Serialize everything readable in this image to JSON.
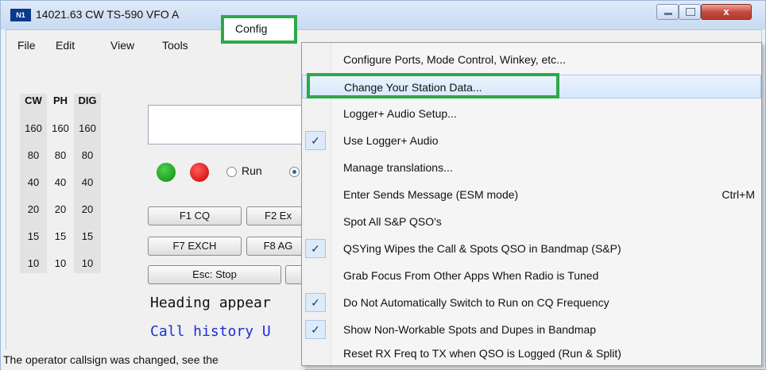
{
  "window": {
    "title": "14021.63 CW TS-590 VFO A",
    "icon_text": "N1",
    "close_label": "x"
  },
  "menubar": {
    "items": [
      "File",
      "Edit",
      "View",
      "Tools",
      "Config"
    ]
  },
  "band_table": {
    "headers": [
      "CW",
      "PH",
      "DIG"
    ],
    "rows": [
      [
        "160",
        "160",
        "160"
      ],
      [
        "80",
        "80",
        "80"
      ],
      [
        "40",
        "40",
        "40"
      ],
      [
        "20",
        "20",
        "20"
      ],
      [
        "15",
        "15",
        "15"
      ],
      [
        "10",
        "10",
        "10"
      ]
    ]
  },
  "mode": {
    "run_label": "Run",
    "selected": "second"
  },
  "function_keys": [
    "F1 CQ",
    "F2 Ex",
    "F7 EXCH",
    "F8 AG",
    "Esc: Stop"
  ],
  "text_lines": {
    "heading": "Heading appear",
    "call_history": "Call history U"
  },
  "status_bar": {
    "text": "The operator callsign was changed, see the"
  },
  "config_menu": {
    "items": [
      {
        "label": "Configure Ports, Mode Control, Winkey, etc...",
        "checked": false,
        "shortcut": ""
      },
      {
        "label": "Change Your Station Data...",
        "checked": false,
        "shortcut": "",
        "highlighted": true
      },
      {
        "label": "Logger+ Audio Setup...",
        "checked": false,
        "shortcut": ""
      },
      {
        "label": "Use Logger+ Audio",
        "checked": true,
        "shortcut": ""
      },
      {
        "label": "Manage translations...",
        "checked": false,
        "shortcut": ""
      },
      {
        "label": "Enter Sends Message (ESM mode)",
        "checked": false,
        "shortcut": "Ctrl+M"
      },
      {
        "label": "Spot All S&P QSO's",
        "checked": false,
        "shortcut": ""
      },
      {
        "label": "QSYing Wipes the Call & Spots QSO in Bandmap (S&P)",
        "checked": true,
        "shortcut": ""
      },
      {
        "label": "Grab Focus From Other Apps When Radio is Tuned",
        "checked": false,
        "shortcut": ""
      },
      {
        "label": "Do Not Automatically Switch to Run on CQ Frequency",
        "checked": true,
        "shortcut": ""
      },
      {
        "label": "Show Non-Workable Spots and Dupes in Bandmap",
        "checked": true,
        "shortcut": ""
      },
      {
        "label": "Reset RX Freq to TX when QSO is Logged (Run & Split)",
        "checked": false,
        "shortcut": ""
      }
    ],
    "check_glyph": "✓"
  },
  "colors": {
    "highlight_box": "#2ea84a",
    "call_history_text": "#1c2fd8",
    "run_indicator": "#108a10",
    "stop_indicator": "#cc0000"
  }
}
